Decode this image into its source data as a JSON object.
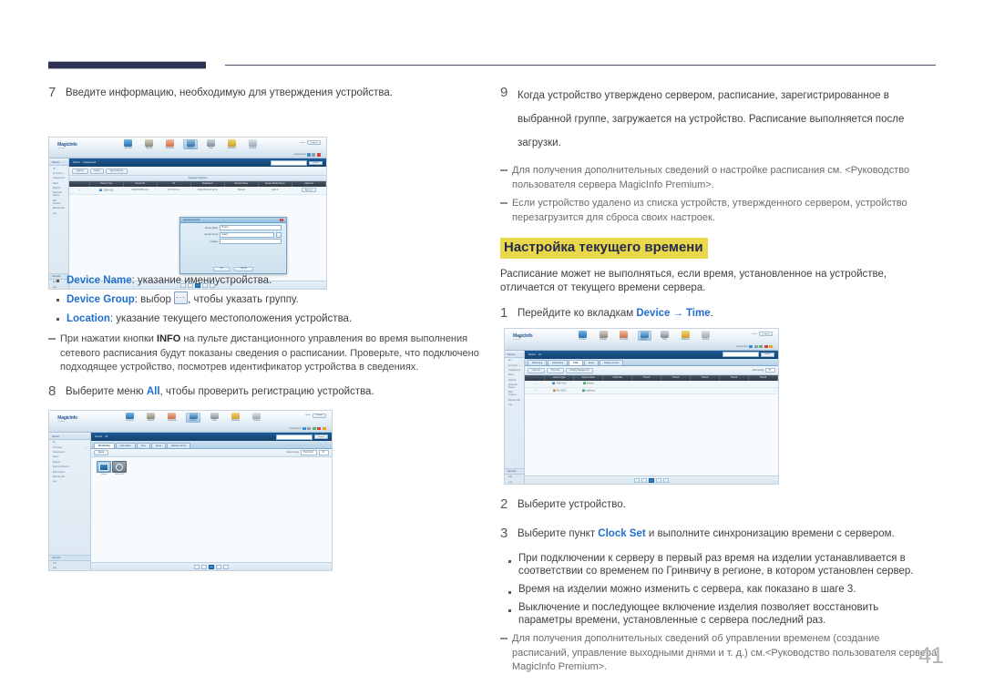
{
  "page": {
    "number": "41"
  },
  "left_column": {
    "step7": {
      "num": "7",
      "text": "Введите информацию, необходимую для утверждения устройства."
    },
    "bullets": [
      {
        "term": "Device Name",
        "rest": ": указание имениустройства."
      },
      {
        "term": "Device Group",
        "rest_before": ": выбор ",
        "rest_after": ", чтобы указать группу.",
        "icon": "ellipsis-button-icon"
      },
      {
        "term": "Location",
        "rest": ": указание текущего местоположения устройства."
      }
    ],
    "note_info": {
      "part1": "При нажатии кнопки ",
      "keyword": "INFO",
      "part2": " на пульте дистанционного управления во время выполнения сетевого расписания будут показаны сведения о расписании. Проверьте, что подключено подходящее устройство, посмотрев идентификатор устройства в сведениях."
    },
    "step8": {
      "num": "8",
      "part1": "Выберите меню ",
      "keyword": "All",
      "part2": ", чтобы проверить регистрацию устройства."
    }
  },
  "right_column": {
    "step9": {
      "num": "9",
      "text": "Когда устройство утверждено сервером, расписание, зарегистрированное в выбранной группе, загружается на устройство. Расписание выполняется после загрузки."
    },
    "notes": [
      "Для получения дополнительных сведений о настройке расписания см. <Руководство пользователя сервера MagicInfo Premium>.",
      "Если устройство удалено из списка устройств, утвержденного сервером, устройство перезагрузится для сброса своих настроек."
    ],
    "section_heading": "Настройка текущего времени",
    "section_intro": "Расписание может не выполняться, если время, установленное на устройстве, отличается от текущего времени сервера.",
    "step1": {
      "num": "1",
      "part1": "Перейдите ко вкладкам ",
      "link1": "Device",
      "arrow": "→",
      "link2": "Time",
      "part2": "."
    },
    "step2": {
      "num": "2",
      "text": "Выберите устройство."
    },
    "step3": {
      "num": "3",
      "part1": "Выберите пункт ",
      "keyword": "Clock Set",
      "part2": " и выполните синхронизацию времени с сервером."
    },
    "bullets": [
      "При подключении к серверу в первый раз время на изделии устанавливается в соответствии со временем по Гринвичу в регионе, в котором установлен сервер.",
      "Время на изделии можно изменить с сервера, как показано в шаге 3.",
      "Выключение и последующее включение изделия позволяет восстановить параметры времени, установленные с сервера последний раз."
    ],
    "final_note": "Для получения дополнительных сведений об управлении временем (создание расписаний, управление выходными днями и т. д.) см.<Руководство пользователя сервера MagicInfo Premium>."
  },
  "screenshot_approve": {
    "alt": "MagicInfo device approval dialog",
    "logo": "MagicInfo",
    "logo_sub": "Premium",
    "nav": [
      {
        "label": "Content",
        "icon": "content-icon"
      },
      {
        "label": "Playlist",
        "icon": "playlist-icon"
      },
      {
        "label": "Schedule",
        "icon": "schedule-icon"
      },
      {
        "label": "Device",
        "icon": "device-icon"
      },
      {
        "label": "User",
        "icon": "user-icon"
      },
      {
        "label": "Statistics",
        "icon": "statistics-icon"
      },
      {
        "label": "Setting",
        "icon": "setting-icon"
      }
    ],
    "account": {
      "user_label": "admin",
      "logout_label": "Logout",
      "connect_label": "Connected"
    },
    "sidebar_title": "Device",
    "sidebar_items": [
      "All",
      "by Group",
      "Unapproved",
      "Alarm",
      "Expired"
    ],
    "sidebar_items2": [
      "Approval Device",
      "Edit Content",
      "Remote Job",
      "Log"
    ],
    "sidebar_bottom": [
      "General",
      "Info",
      "Log"
    ],
    "crumb": [
      "Device",
      "Unapproved"
    ],
    "search_button": "Search",
    "toolbar": [
      "Approve",
      "Delete",
      "Report Device"
    ],
    "group_header": "Category Selection",
    "columns": [
      "",
      "Device Type",
      "Device ID",
      "IP",
      "Registered",
      "Device Name",
      "Device Model Name",
      "Approval"
    ],
    "rows": [
      [
        "",
        "SNB-4120",
        "0x00:0F:0B:xx:0x",
        "127.0.0.1:xx",
        "2012-05-01 11:22:12",
        "Monitor",
        "LED-D",
        "Approve"
      ]
    ],
    "modal": {
      "title": "Approve Device",
      "fields": [
        {
          "label": "Device Name",
          "value": "Monitor"
        },
        {
          "label": "Device Group",
          "value": "default"
        },
        {
          "label": "Location",
          "value": ""
        }
      ],
      "ok": "OK",
      "cancel": "Cancel"
    }
  },
  "screenshot_all": {
    "alt": "MagicInfo device list All view",
    "logo": "MagicInfo",
    "logo_sub": "Premium",
    "nav": [
      {
        "label": "Content",
        "icon": "content-icon"
      },
      {
        "label": "Playlist",
        "icon": "playlist-icon"
      },
      {
        "label": "Schedule",
        "icon": "schedule-icon"
      },
      {
        "label": "Device",
        "icon": "device-icon"
      },
      {
        "label": "User",
        "icon": "user-icon"
      },
      {
        "label": "Statistics",
        "icon": "statistics-icon"
      },
      {
        "label": "Setting",
        "icon": "setting-icon"
      }
    ],
    "account": {
      "user_label": "admin",
      "logout_label": "Logout",
      "connect_label": "Connected"
    },
    "sidebar_title": "Device",
    "sidebar_items": [
      "All",
      "by Group",
      "Unapproved",
      "Alarm",
      "Expired"
    ],
    "sidebar_items2": [
      "Approval Device",
      "Edit Content",
      "Remote Job",
      "Log"
    ],
    "sidebar_bottom": [
      "General",
      "Info",
      "Log"
    ],
    "crumb": [
      "Device",
      "All"
    ],
    "search_button": "Search",
    "tabs": [
      "Monitoring",
      "Information",
      "Time",
      "Setup",
      "Display Control"
    ],
    "toolbar": [
      "Delete"
    ],
    "filter_label": "Select Group",
    "filter_value": "Thumbnail",
    "filter_value2": "All",
    "tiles": [
      {
        "caption": "Device",
        "icon": "monitor-tile-icon"
      },
      {
        "caption": "SNB-4120",
        "icon": "power-tile-icon"
      }
    ]
  },
  "screenshot_time": {
    "alt": "MagicInfo Device Time tab",
    "logo": "MagicInfo",
    "logo_sub": "Premium",
    "nav": [
      {
        "label": "Content",
        "icon": "content-icon"
      },
      {
        "label": "Playlist",
        "icon": "playlist-icon"
      },
      {
        "label": "Schedule",
        "icon": "schedule-icon"
      },
      {
        "label": "Device",
        "icon": "device-icon"
      },
      {
        "label": "User",
        "icon": "user-icon"
      },
      {
        "label": "Statistics",
        "icon": "statistics-icon"
      },
      {
        "label": "Setting",
        "icon": "setting-icon"
      }
    ],
    "account": {
      "user_label": "admin",
      "logout_label": "Logout",
      "connect_label": "Connected"
    },
    "sidebar_title": "Device",
    "sidebar_items": [
      "All",
      "by Group",
      "Unapproved",
      "Alarm",
      "Expired"
    ],
    "sidebar_items2": [
      "Approval Device",
      "Edit Content",
      "Remote Job",
      "Log"
    ],
    "sidebar_bottom": [
      "General",
      "Info",
      "Log"
    ],
    "crumb": [
      "Device",
      "All"
    ],
    "search_button": "Search",
    "tabs": [
      "Monitoring",
      "Information",
      "Time",
      "Setup",
      "Display Control"
    ],
    "toolbar": [
      "Clock Set",
      "Timer Set",
      "Holiday Management"
    ],
    "filter_label": "View Setting",
    "filter_value": "All",
    "columns": [
      "",
      "Device Type",
      "Device Name",
      "Clock Set",
      "Timer1",
      "Timer2",
      "Timer3",
      "Timer4",
      "Timer5"
    ],
    "rows": [
      [
        "",
        "SNB-4120",
        "Monitor",
        "",
        "",
        "",
        "",
        "",
        ""
      ],
      [
        "",
        "PIL-4120",
        "myDevice",
        "",
        "",
        "",
        "",
        "",
        ""
      ]
    ]
  },
  "colors": {
    "link_blue": "#1f6fd0",
    "heading_bg": "#e8d84a",
    "heading_fg": "#262a4e",
    "rule_navy": "#2e3154",
    "page_number": "#b4b4b8"
  }
}
